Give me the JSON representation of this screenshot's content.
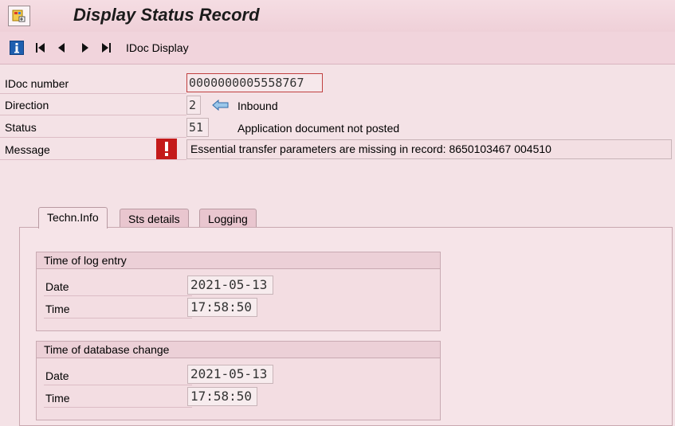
{
  "window": {
    "title": "Display Status Record"
  },
  "toolbar": {
    "buttons": [
      {
        "name": "info-button",
        "icon": "info-icon"
      },
      {
        "name": "first-button",
        "icon": "first-icon"
      },
      {
        "name": "previous-button",
        "icon": "previous-icon"
      },
      {
        "name": "next-button",
        "icon": "next-icon"
      },
      {
        "name": "last-button",
        "icon": "last-icon"
      }
    ],
    "idoc_display_label": "IDoc Display"
  },
  "header": {
    "idoc_number_label": "IDoc number",
    "idoc_number_value": "0000000005558767",
    "direction_label": "Direction",
    "direction_value": "2",
    "direction_text": "Inbound",
    "direction_icon": "arrow-left-icon",
    "status_label": "Status",
    "status_value": "51",
    "status_text": "Application document not posted",
    "message_label": "Message",
    "message_icon": "error-icon",
    "message_text": "Essential transfer parameters are missing in record: 8650103467 004510"
  },
  "tabs": [
    {
      "label": "Techn.Info",
      "active": true
    },
    {
      "label": "Sts details",
      "active": false
    },
    {
      "label": "Logging",
      "active": false
    }
  ],
  "log_entry": {
    "title": "Time of log entry",
    "date_label": "Date",
    "date_value": "2021-05-13",
    "time_label": "Time",
    "time_value": "17:58:50"
  },
  "db_change": {
    "title": "Time of database change",
    "date_label": "Date",
    "date_value": "2021-05-13",
    "time_label": "Time",
    "time_value": "17:58:50"
  },
  "colors": {
    "background": "#f4e2e6",
    "toolbar": "#f1d4dc",
    "error_red": "#c41a1a",
    "icon_blue": "#1f5fb0"
  }
}
